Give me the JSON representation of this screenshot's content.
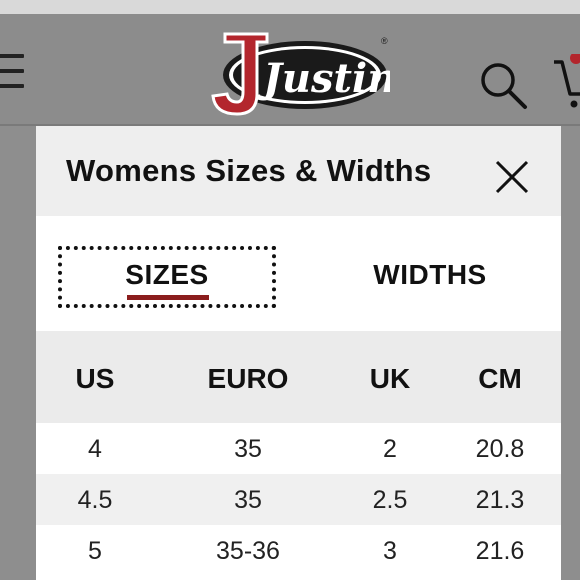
{
  "header": {
    "logo_text": "Justin",
    "menu_icon": "hamburger-icon",
    "search_icon": "search-icon",
    "cart_icon": "cart-icon"
  },
  "modal": {
    "title": "Womens Sizes & Widths",
    "close_icon": "close-icon",
    "tabs": [
      {
        "label": "SIZES",
        "active": true
      },
      {
        "label": "WIDTHS",
        "active": false
      }
    ],
    "accent_color": "#8b1d1d"
  },
  "table": {
    "columns": [
      "US",
      "EURO",
      "UK",
      "CM"
    ],
    "rows": [
      [
        "4",
        "35",
        "2",
        "20.8"
      ],
      [
        "4.5",
        "35",
        "2.5",
        "21.3"
      ],
      [
        "5",
        "35-36",
        "3",
        "21.6"
      ]
    ]
  }
}
